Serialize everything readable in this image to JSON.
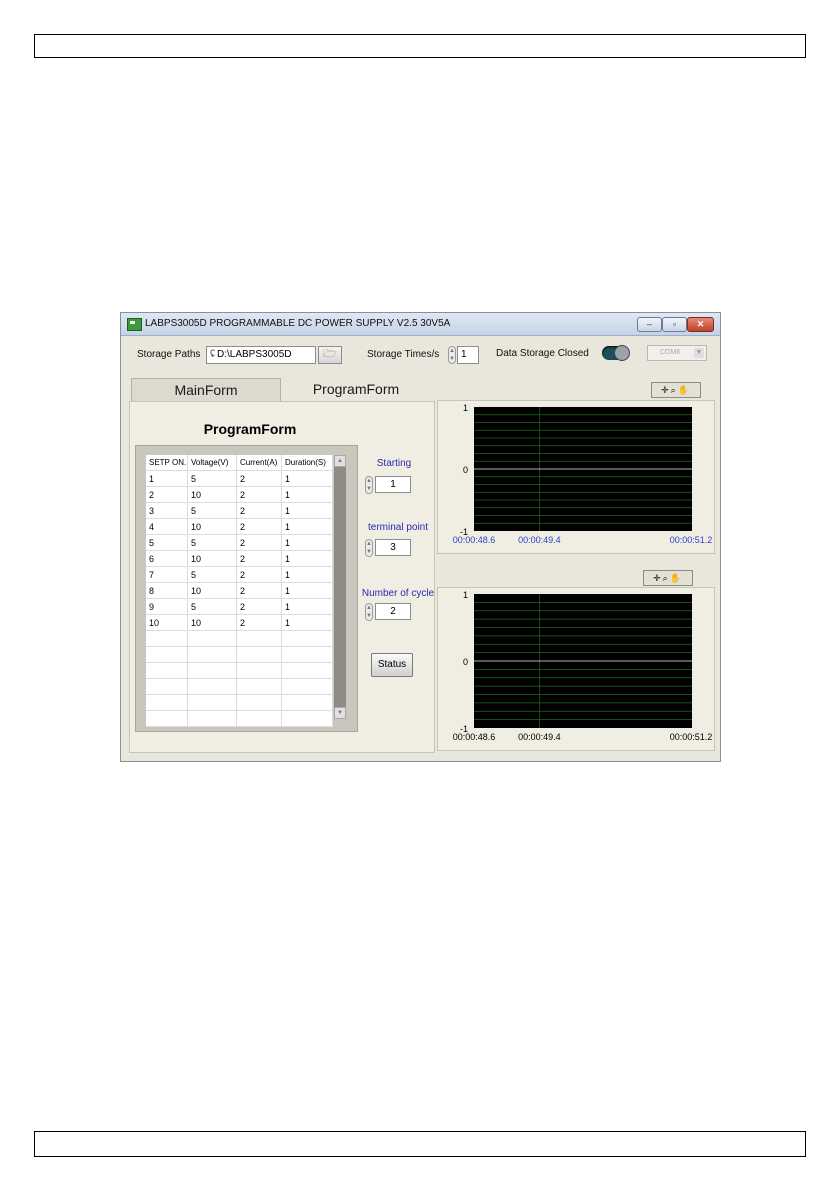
{
  "window": {
    "title": "LABPS3005D PROGRAMMABLE DC POWER SUPPLY V2.5  30V5A",
    "controls": {
      "minimize": "–",
      "maximize": "▫",
      "close": "✕"
    }
  },
  "toolbar": {
    "storage_paths_label": "Storage Paths",
    "path_marker": "ʢ",
    "storage_path_value": "D:\\LABPS3005D",
    "browse_icon": "folder-open-icon",
    "storage_times_label": "Storage Times/s",
    "storage_times_value": "1",
    "data_storage_label": "Data Storage Closed",
    "com_port_value": "COM6"
  },
  "tabs": [
    {
      "label": "MainForm"
    },
    {
      "label": "ProgramForm"
    }
  ],
  "program_form": {
    "title": "ProgramForm",
    "table": {
      "headers": [
        "SETP ON.",
        "Voltage(V)",
        "Current(A)",
        "Duration(S)"
      ],
      "rows": [
        [
          "1",
          "5",
          "2",
          "1"
        ],
        [
          "2",
          "10",
          "2",
          "1"
        ],
        [
          "3",
          "5",
          "2",
          "1"
        ],
        [
          "4",
          "10",
          "2",
          "1"
        ],
        [
          "5",
          "5",
          "2",
          "1"
        ],
        [
          "6",
          "10",
          "2",
          "1"
        ],
        [
          "7",
          "5",
          "2",
          "1"
        ],
        [
          "8",
          "10",
          "2",
          "1"
        ],
        [
          "9",
          "5",
          "2",
          "1"
        ],
        [
          "10",
          "10",
          "2",
          "1"
        ]
      ],
      "empty_rows": 6
    },
    "starting": {
      "label": "Starting",
      "value": "1"
    },
    "terminal_point": {
      "label": "terminal point",
      "value": "3"
    },
    "number_of_cycle": {
      "label": "Number of cycle",
      "value": "2"
    },
    "status_button": "Status"
  },
  "charts": [
    {
      "y_ticks": [
        "1",
        "0",
        "-1"
      ],
      "x_ticks": [
        "00:00:48.6",
        "00:00:49.4",
        "00:00:51.2"
      ],
      "tick_color": "#2b40c8",
      "plot_bg": "#000000",
      "grid_color": "#1f6b1f",
      "tools": [
        "cursor-icon",
        "zoom-icon",
        "pan-hand-icon"
      ]
    },
    {
      "y_ticks": [
        "1",
        "0",
        "-1"
      ],
      "x_ticks": [
        "00:00:48.6",
        "00:00:49.4",
        "00:00:51.2"
      ],
      "tick_color": "#000000",
      "plot_bg": "#000000",
      "grid_color": "#1f6b1f",
      "tools": [
        "cursor-icon",
        "zoom-icon",
        "pan-hand-icon"
      ]
    }
  ]
}
